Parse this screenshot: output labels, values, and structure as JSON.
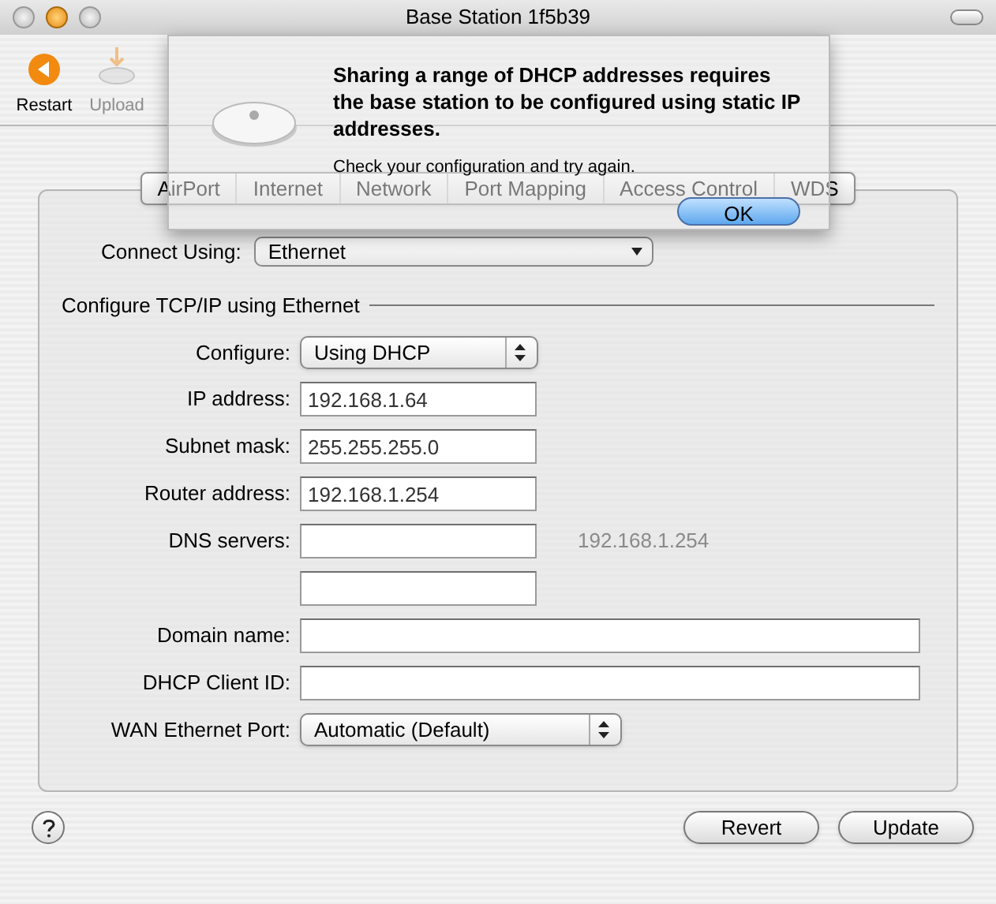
{
  "window": {
    "title": "Base Station 1f5b39"
  },
  "toolbar": [
    {
      "label": "Restart",
      "disabled": false
    },
    {
      "label": "Upload",
      "disabled": true
    }
  ],
  "tabs": [
    {
      "label": "AirPort"
    },
    {
      "label": "Internet"
    },
    {
      "label": "Network"
    },
    {
      "label": "Port Mapping"
    },
    {
      "label": "Access Control"
    },
    {
      "label": "WDS"
    }
  ],
  "connect_using": {
    "label": "Connect Using:",
    "value": "Ethernet"
  },
  "section_title": "Configure TCP/IP using Ethernet",
  "fields": [
    {
      "kind": "popup",
      "label": "Configure:",
      "value": "Using DHCP"
    },
    {
      "kind": "text",
      "label": "IP address:",
      "value": "192.168.1.64"
    },
    {
      "kind": "text",
      "label": "Subnet mask:",
      "value": "255.255.255.0"
    },
    {
      "kind": "text",
      "label": "Router address:",
      "value": "192.168.1.254"
    },
    {
      "kind": "text",
      "label": "DNS servers:",
      "note": "192.168.1.254"
    },
    {
      "kind": "text"
    },
    {
      "kind": "wide",
      "label": "Domain name:"
    },
    {
      "kind": "wide",
      "label": "DHCP Client ID:"
    },
    {
      "kind": "popup-wide",
      "label": "WAN Ethernet Port:",
      "value": "Automatic (Default)"
    }
  ],
  "buttons": [
    "Revert",
    "Update"
  ],
  "alert": {
    "title": "Sharing a range of DHCP addresses requires the base station to be configured using static IP addresses.",
    "message": "Check your configuration and try again.",
    "button": "OK"
  }
}
